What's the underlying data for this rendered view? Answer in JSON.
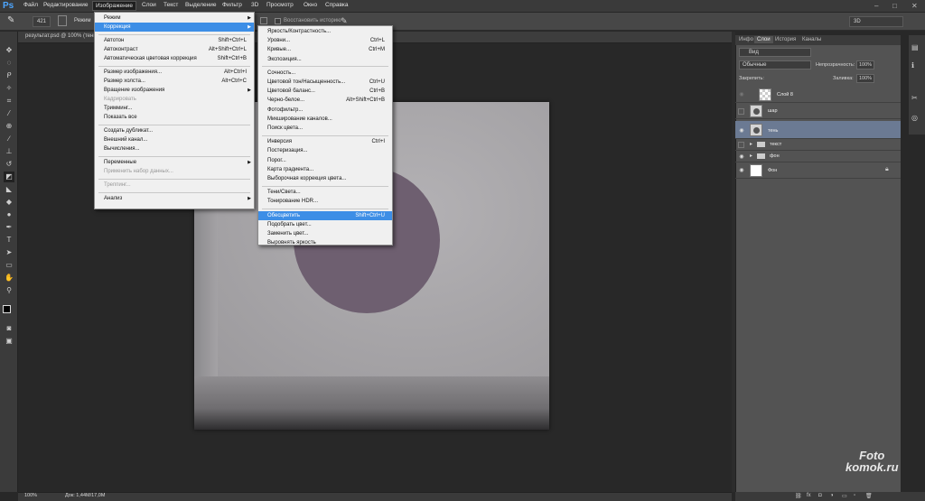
{
  "app": {
    "logo": "Ps",
    "window_controls": [
      "‒",
      "□",
      "✕"
    ]
  },
  "menubar": [
    "Файл",
    "Редактирование",
    "Изображение",
    "Слои",
    "Текст",
    "Выделение",
    "Фильтр",
    "3D",
    "Просмотр",
    "Окно",
    "Справка"
  ],
  "options_bar": {
    "brush_size": "421",
    "mode_label": "Режим",
    "restore_history": "Восстановить историю",
    "workspace": "3D"
  },
  "document": {
    "tab_label": "результат.psd @ 100% (тень..."
  },
  "status": {
    "zoom": "100%",
    "doc_size": "Док: 1,44M/17,0M"
  },
  "image_menu": [
    {
      "label": "Режим",
      "shortcut": "",
      "submenu": true,
      "disabled": false
    },
    {
      "label": "Коррекция",
      "shortcut": "",
      "submenu": true,
      "disabled": false,
      "active": true
    },
    {
      "sep": true
    },
    {
      "label": "Автотон",
      "shortcut": "Shift+Ctrl+L"
    },
    {
      "label": "Автоконтраст",
      "shortcut": "Alt+Shift+Ctrl+L"
    },
    {
      "label": "Автоматическая цветовая коррекция",
      "shortcut": "Shift+Ctrl+B"
    },
    {
      "sep": true
    },
    {
      "label": "Размер изображения...",
      "shortcut": "Alt+Ctrl+I"
    },
    {
      "label": "Размер холста...",
      "shortcut": "Alt+Ctrl+C"
    },
    {
      "label": "Вращение изображения",
      "shortcut": "",
      "submenu": true
    },
    {
      "label": "Кадрировать",
      "shortcut": "",
      "disabled": true
    },
    {
      "label": "Тримминг...",
      "shortcut": ""
    },
    {
      "label": "Показать все",
      "shortcut": ""
    },
    {
      "sep": true
    },
    {
      "label": "Создать дубликат...",
      "shortcut": ""
    },
    {
      "label": "Внешний канал...",
      "shortcut": ""
    },
    {
      "label": "Вычисления...",
      "shortcut": ""
    },
    {
      "sep": true
    },
    {
      "label": "Переменные",
      "shortcut": "",
      "submenu": true
    },
    {
      "label": "Применить набор данных...",
      "shortcut": "",
      "disabled": true
    },
    {
      "sep": true
    },
    {
      "label": "Треппинг...",
      "shortcut": "",
      "disabled": true
    },
    {
      "sep": true
    },
    {
      "label": "Анализ",
      "shortcut": "",
      "submenu": true
    }
  ],
  "correction_menu": [
    {
      "label": "Яркость/Контрастность...",
      "shortcut": ""
    },
    {
      "label": "Уровни...",
      "shortcut": "Ctrl+L"
    },
    {
      "label": "Кривые...",
      "shortcut": "Ctrl+M"
    },
    {
      "label": "Экспозиция...",
      "shortcut": ""
    },
    {
      "sep": true
    },
    {
      "label": "Сочность...",
      "shortcut": ""
    },
    {
      "label": "Цветовой тон/Насыщенность...",
      "shortcut": "Ctrl+U"
    },
    {
      "label": "Цветовой баланс...",
      "shortcut": "Ctrl+B"
    },
    {
      "label": "Черно-белое...",
      "shortcut": "Alt+Shift+Ctrl+B"
    },
    {
      "label": "Фотофильтр...",
      "shortcut": ""
    },
    {
      "label": "Микширование каналов...",
      "shortcut": ""
    },
    {
      "label": "Поиск цвета...",
      "shortcut": ""
    },
    {
      "sep": true
    },
    {
      "label": "Инверсия",
      "shortcut": "Ctrl+I"
    },
    {
      "label": "Постеризация...",
      "shortcut": ""
    },
    {
      "label": "Порог...",
      "shortcut": ""
    },
    {
      "label": "Карта градиента...",
      "shortcut": ""
    },
    {
      "label": "Выборочная коррекция цвета...",
      "shortcut": ""
    },
    {
      "sep": true
    },
    {
      "label": "Тени/Света...",
      "shortcut": ""
    },
    {
      "label": "Тонирование HDR...",
      "shortcut": ""
    },
    {
      "sep": true
    },
    {
      "label": "Обесцветить",
      "shortcut": "Shift+Ctrl+U",
      "highlighted": true
    },
    {
      "label": "Подобрать цвет...",
      "shortcut": ""
    },
    {
      "label": "Заменить цвет...",
      "shortcut": ""
    },
    {
      "label": "Выровнять яркость",
      "shortcut": ""
    }
  ],
  "panel": {
    "tabs": [
      "Инфо",
      "Слои",
      "История",
      "Каналы"
    ],
    "filter_label": "Вид",
    "blend_mode": "Обычные",
    "opacity_label": "Непрозрачность:",
    "opacity": "100%",
    "lock_label": "Закрепить:",
    "fill_label": "Заливка:",
    "fill": "100%",
    "layers": [
      {
        "name": "Слой 8",
        "visible": false,
        "selected": false
      },
      {
        "name": "шар",
        "visible": false,
        "selected": false
      },
      {
        "name": "тень",
        "visible": true,
        "selected": true
      },
      {
        "name": "текст",
        "visible": false,
        "selected": false,
        "folder": true
      },
      {
        "name": "фон",
        "visible": true,
        "selected": false,
        "folder": true
      },
      {
        "name": "Фон",
        "visible": true,
        "selected": false,
        "locked": true
      }
    ]
  },
  "watermark": {
    "line1": "Foto",
    "line2": "komok.ru"
  }
}
